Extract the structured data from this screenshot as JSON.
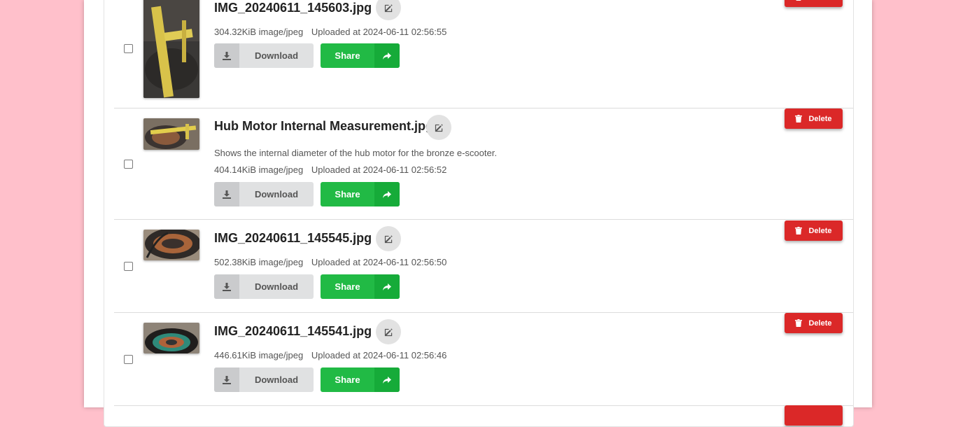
{
  "labels": {
    "download": "Download",
    "share": "Share",
    "delete": "Delete"
  },
  "files": [
    {
      "name": "IMG_20240611_145603.jpg",
      "description": "",
      "size": "304.32KiB",
      "mime": "image/jpeg",
      "uploaded": "Uploaded at 2024-06-11 02:56:55"
    },
    {
      "name": "Hub Motor Internal Measurement.jpg",
      "description": "Shows the internal diameter of the hub motor for the bronze e-scooter.",
      "size": "404.14KiB",
      "mime": "image/jpeg",
      "uploaded": "Uploaded at 2024-06-11 02:56:52"
    },
    {
      "name": "IMG_20240611_145545.jpg",
      "description": "",
      "size": "502.38KiB",
      "mime": "image/jpeg",
      "uploaded": "Uploaded at 2024-06-11 02:56:50"
    },
    {
      "name": "IMG_20240611_145541.jpg",
      "description": "",
      "size": "446.61KiB",
      "mime": "image/jpeg",
      "uploaded": "Uploaded at 2024-06-11 02:56:46"
    }
  ],
  "colors": {
    "background": "#ffc0cb",
    "share": "#21ba45",
    "delete": "#db2828"
  },
  "icons": {
    "edit": "edit-icon",
    "download": "download-icon",
    "share": "share-arrow-icon",
    "delete": "trash-icon"
  }
}
